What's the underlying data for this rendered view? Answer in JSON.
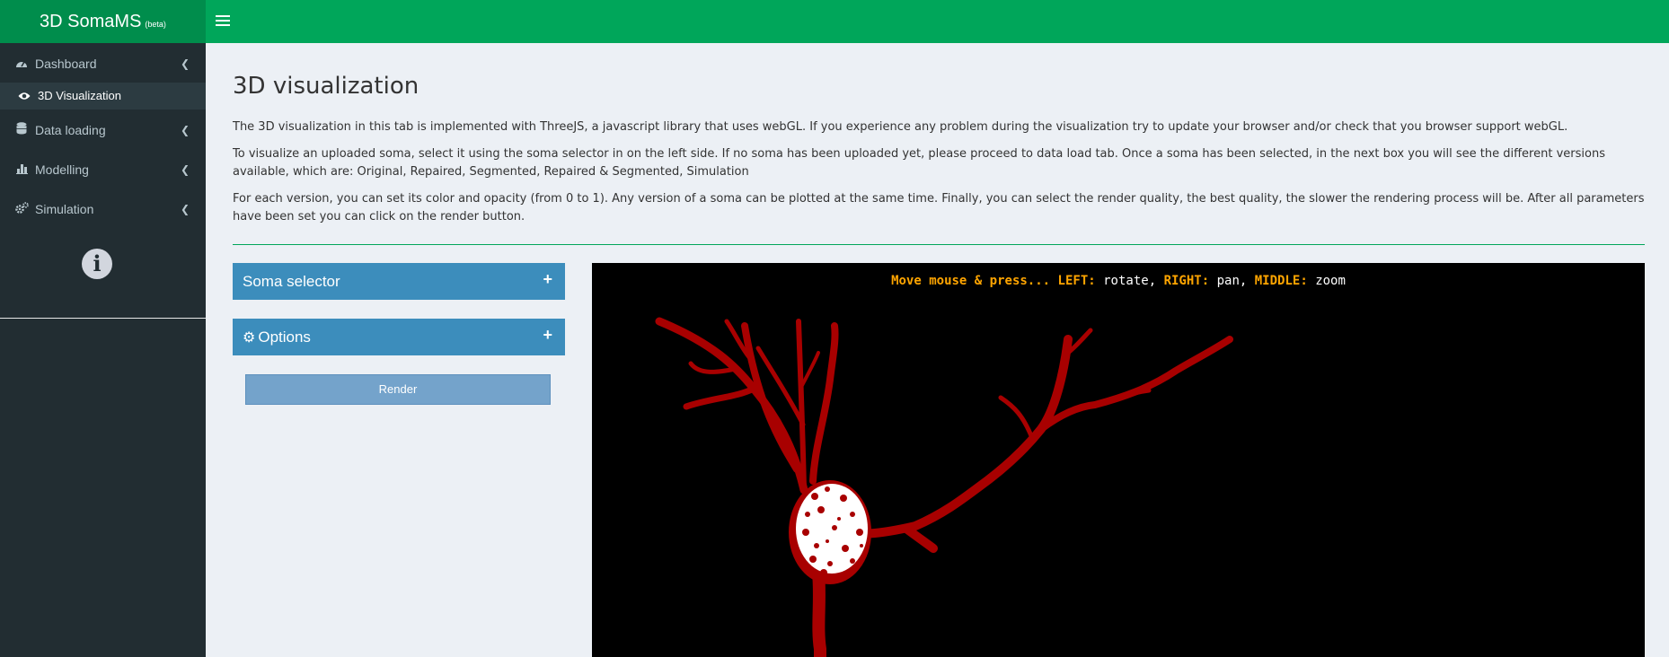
{
  "app": {
    "title": "3D SomaMS",
    "badge": "(beta)"
  },
  "sidebar": {
    "items": [
      {
        "label": "Dashboard",
        "icon": "dashboard-icon"
      },
      {
        "label": "3D Visualization",
        "icon": "eye-icon",
        "active": true
      },
      {
        "label": "Data loading",
        "icon": "database-icon"
      },
      {
        "label": "Modelling",
        "icon": "bar-chart-icon"
      },
      {
        "label": "Simulation",
        "icon": "cogs-icon"
      }
    ],
    "info_icon": "info-icon"
  },
  "main": {
    "title": "3D visualization",
    "paragraphs": [
      "The 3D visualization in this tab is implemented with ThreeJS, a javascript library that uses webGL. If you experience any problem during the visualization try to update your browser and/or check that you browser support webGL.",
      "To visualize an uploaded soma, select it using the soma selector in on the left side. If no soma has been uploaded yet, please proceed to data load tab. Once a soma has been selected, in the next box you will see the different versions available, which are: Original, Repaired, Segmented, Repaired & Segmented, Simulation",
      "For each version, you can set its color and opacity (from 0 to 1). Any version of a soma can be plotted at the same time. Finally, you can select the render quality, the best quality, the slower the rendering process will be. After all parameters have been set you can click on the render button."
    ],
    "soma_selector": {
      "title": "Soma selector",
      "expand": "+"
    },
    "options": {
      "title": "Options",
      "expand": "+"
    },
    "render_button": "Render",
    "viewer": {
      "hint_prefix": "Move mouse & press...",
      "left_key": "LEFT:",
      "left_action": "rotate,",
      "right_key": "RIGHT:",
      "right_action": "pan,",
      "middle_key": "MIDDLE:",
      "middle_action": "zoom",
      "neuron_color": "#b00000",
      "soma_color": "#ffffff"
    }
  },
  "colors": {
    "header": "#00a65a",
    "logo_bg": "#008d4c",
    "sidebar": "#222d32",
    "box": "#3c8dbc"
  }
}
